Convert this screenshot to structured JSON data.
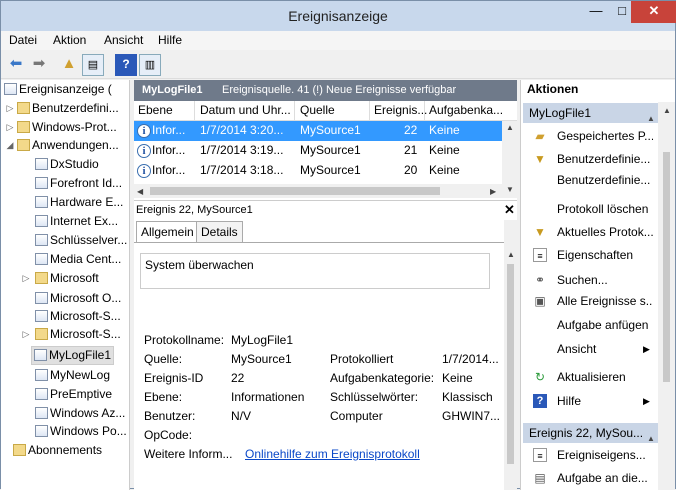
{
  "window": {
    "title": "Ereignisanzeige",
    "min": "—",
    "max": "□",
    "close": "✕"
  },
  "menu": [
    "Datei",
    "Aktion",
    "Ansicht",
    "Hilfe"
  ],
  "tree": {
    "root": "Ereignisanzeige (",
    "items": [
      "Benutzerdefini...",
      "Windows-Prot...",
      "Anwendungen..."
    ],
    "sub": [
      "DxStudio",
      "Forefront Id...",
      "Hardware E...",
      "Internet Ex...",
      "Schlüsselver...",
      "Media Cent...",
      "Microsoft",
      "Microsoft O...",
      "Microsoft-S...",
      "Microsoft-S...",
      "MyLogFile1",
      "MyNewLog",
      "PreEmptive",
      "Windows Az...",
      "Windows Po..."
    ],
    "abonnements": "Abonnements"
  },
  "log": {
    "name": "MyLogFile1",
    "status": "Ereignisquelle. 41 (!) Neue Ereignisse verfügbar",
    "columns": [
      "Ebene",
      "Datum und Uhr...",
      "Quelle",
      "Ereignis...",
      "Aufgabenka..."
    ],
    "rows": [
      {
        "level": "Infor...",
        "date": "1/7/2014 3:20...",
        "source": "MySource1",
        "id": "22",
        "task": "Keine"
      },
      {
        "level": "Infor...",
        "date": "1/7/2014 3:19...",
        "source": "MySource1",
        "id": "21",
        "task": "Keine"
      },
      {
        "level": "Infor...",
        "date": "1/7/2014 3:18...",
        "source": "MySource1",
        "id": "20",
        "task": "Keine"
      }
    ]
  },
  "detail": {
    "header": "Ereignis 22, MySource1",
    "tabs": [
      "Allgemein",
      "Details"
    ],
    "description": "System überwachen",
    "labels": {
      "protokollname": "Protokollname:",
      "quelle": "Quelle:",
      "ereignis_id": "Ereignis-ID",
      "ebene": "Ebene:",
      "benutzer": "Benutzer:",
      "opcode": "OpCode:",
      "weitere": "Weitere Inform...",
      "protokolliert": "Protokolliert",
      "aufgabenkategorie": "Aufgabenkategorie:",
      "schluessel": "Schlüsselwörter:",
      "computer": "Computer"
    },
    "values": {
      "protokollname": "MyLogFile1",
      "quelle": "MySource1",
      "ereignis_id": "22",
      "ebene": "Informationen",
      "benutzer": "N/V",
      "weitere_link": "Onlinehilfe zum Ereignisprotokoll",
      "protokolliert": "1/7/2014...",
      "aufgabenkategorie": "Keine",
      "schluessel": "Klassisch",
      "computer": "GHWIN7..."
    }
  },
  "actions": {
    "title": "Aktionen",
    "section1": "MyLogFile1",
    "items1": [
      "Gespeichertes P...",
      "Benutzerdefinie...",
      "Benutzerdefinie...",
      "Protokoll löschen",
      "Aktuelles Protok...",
      "Eigenschaften",
      "Suchen...",
      "Alle Ereignisse s...",
      "Aufgabe anfügen",
      "Ansicht",
      "Aktualisieren",
      "Hilfe"
    ],
    "section2": "Ereignis 22, MySou...",
    "items2": [
      "Ereigniseigens...",
      "Aufgabe an die..."
    ]
  }
}
